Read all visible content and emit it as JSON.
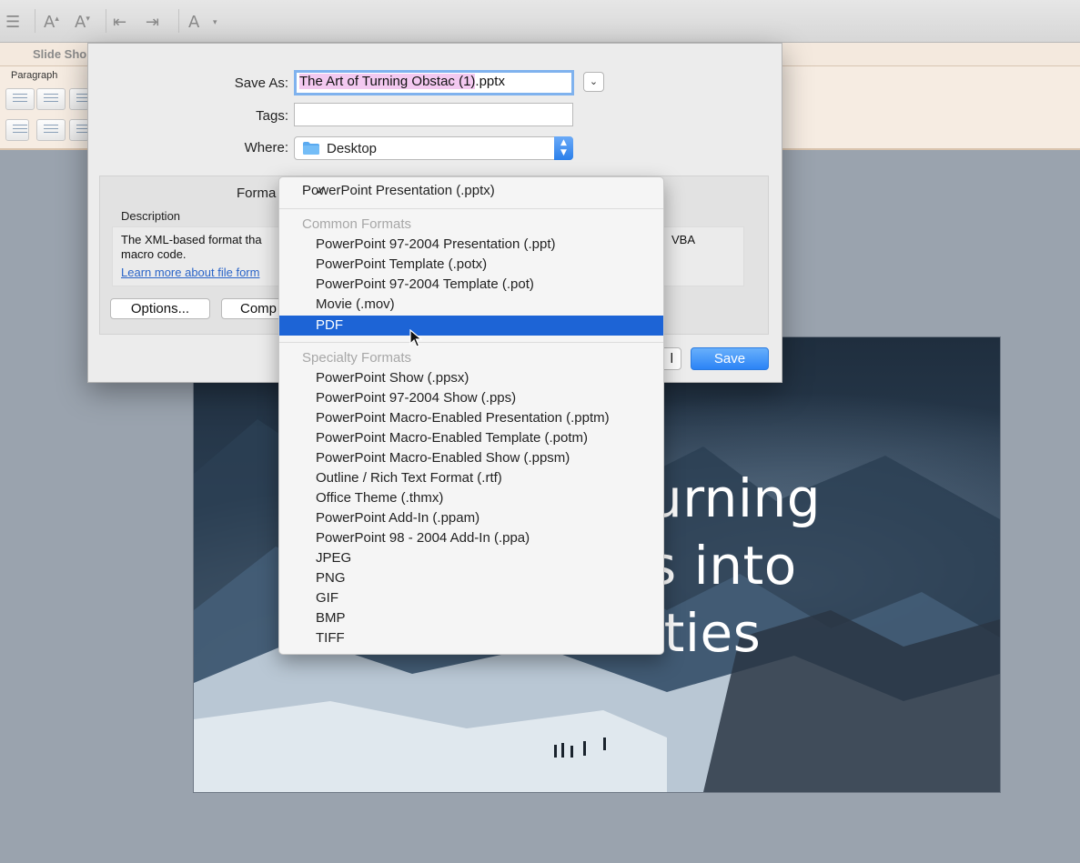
{
  "ribbon": {
    "tab_slideshow": "Slide Sho",
    "group_paragraph": "Paragraph"
  },
  "slide": {
    "title_lines": [
      "urning",
      "s into",
      "ities"
    ]
  },
  "dialog": {
    "save_as_label": "Save As:",
    "filename_selected": "The Art of Turning Obstac (1)",
    "filename_ext": ".pptx",
    "tags_label": "Tags:",
    "tags_value": "",
    "where_label": "Where:",
    "where_value": "Desktop",
    "format_label": "Forma",
    "description_label": "Description",
    "description_text": "The XML-based format tha",
    "description_text2": "macro code.",
    "description_text_right": "VBA",
    "learn_more_link": "Learn more about file form",
    "options_button": "Options...",
    "compat_button": "Comp",
    "cancel_button_fragment": "l",
    "save_button": "Save"
  },
  "format_menu": {
    "checked_item": "PowerPoint Presentation (.pptx)",
    "common_header": "Common Formats",
    "common_items": [
      "PowerPoint 97-2004 Presentation (.ppt)",
      "PowerPoint Template (.potx)",
      "PowerPoint 97-2004 Template (.pot)",
      "Movie (.mov)",
      "PDF"
    ],
    "selected_item": "PDF",
    "specialty_header": "Specialty Formats",
    "specialty_items": [
      "PowerPoint Show (.ppsx)",
      "PowerPoint 97-2004 Show (.pps)",
      "PowerPoint Macro-Enabled Presentation (.pptm)",
      "PowerPoint Macro-Enabled Template (.potm)",
      "PowerPoint Macro-Enabled Show (.ppsm)",
      "Outline / Rich Text Format (.rtf)",
      "Office Theme (.thmx)",
      "PowerPoint Add-In (.ppam)",
      "PowerPoint 98 - 2004 Add-In (.ppa)",
      "JPEG",
      "PNG",
      "GIF",
      "BMP",
      "TIFF"
    ]
  },
  "colors": {
    "accent_blue": "#1d64d6",
    "selection_pink": "#f3c9f0",
    "link_blue": "#2a64c8"
  }
}
